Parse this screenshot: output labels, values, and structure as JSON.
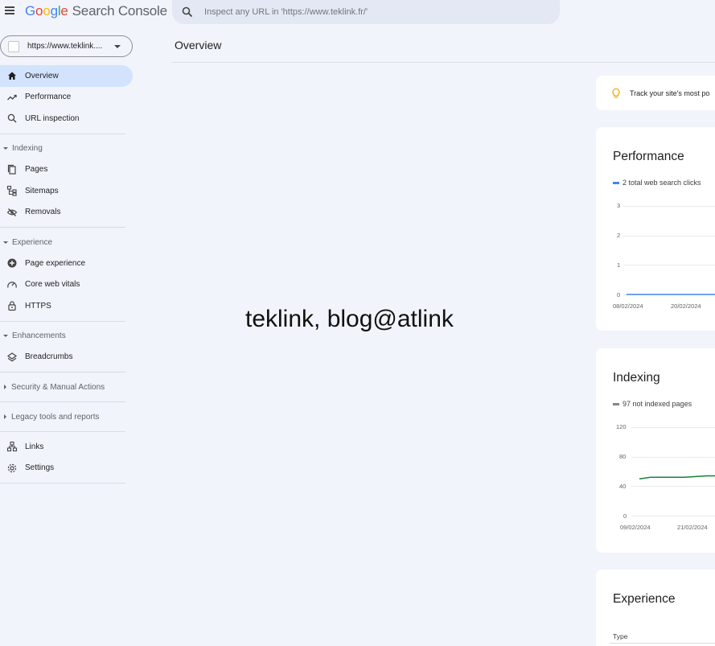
{
  "app": {
    "logo_letters": [
      "G",
      "o",
      "o",
      "g",
      "l",
      "e"
    ],
    "product": "Search Console"
  },
  "search": {
    "placeholder": "Inspect any URL in 'https://www.teklink.fr/'"
  },
  "property": {
    "label": "https://www.teklink...."
  },
  "nav": {
    "overview": "Overview",
    "performance": "Performance",
    "url_inspection": "URL inspection",
    "indexing": "Indexing",
    "pages": "Pages",
    "sitemaps": "Sitemaps",
    "removals": "Removals",
    "experience": "Experience",
    "page_experience": "Page experience",
    "core_web_vitals": "Core web vitals",
    "https": "HTTPS",
    "enhancements": "Enhancements",
    "breadcrumbs": "Breadcrumbs",
    "security": "Security & Manual Actions",
    "legacy": "Legacy tools and reports",
    "links": "Links",
    "settings": "Settings"
  },
  "page": {
    "title": "Overview"
  },
  "watermark": "teklink, blog@atlink",
  "tip": {
    "text": "Track your site's most po"
  },
  "colors": {
    "accent": "#1a73e8",
    "active_bg": "#d3e3fd",
    "index_line": "#188038",
    "tip_icon": "#f9ab00"
  },
  "chart_data": [
    {
      "type": "line",
      "title": "Performance",
      "series": [
        {
          "name": "2 total web search clicks",
          "color": "#4285f4",
          "values": [
            0,
            0,
            0
          ]
        }
      ],
      "x": [
        "08/02/2024",
        "",
        "20/02/2024"
      ],
      "yticks": [
        "3",
        "2",
        "1",
        "0"
      ],
      "ylim": [
        0,
        3
      ]
    },
    {
      "type": "line",
      "title": "Indexing",
      "series": [
        {
          "name": "97 not indexed pages",
          "color": "#188038",
          "values": [
            50,
            52,
            52,
            52,
            52,
            53,
            54,
            54,
            55
          ]
        }
      ],
      "x": [
        "09/02/2024",
        "",
        "21/02/2024"
      ],
      "yticks": [
        "120",
        "80",
        "40",
        "0"
      ],
      "ylim": [
        0,
        120
      ]
    }
  ],
  "experience": {
    "title": "Experience",
    "type_label": "Type"
  }
}
